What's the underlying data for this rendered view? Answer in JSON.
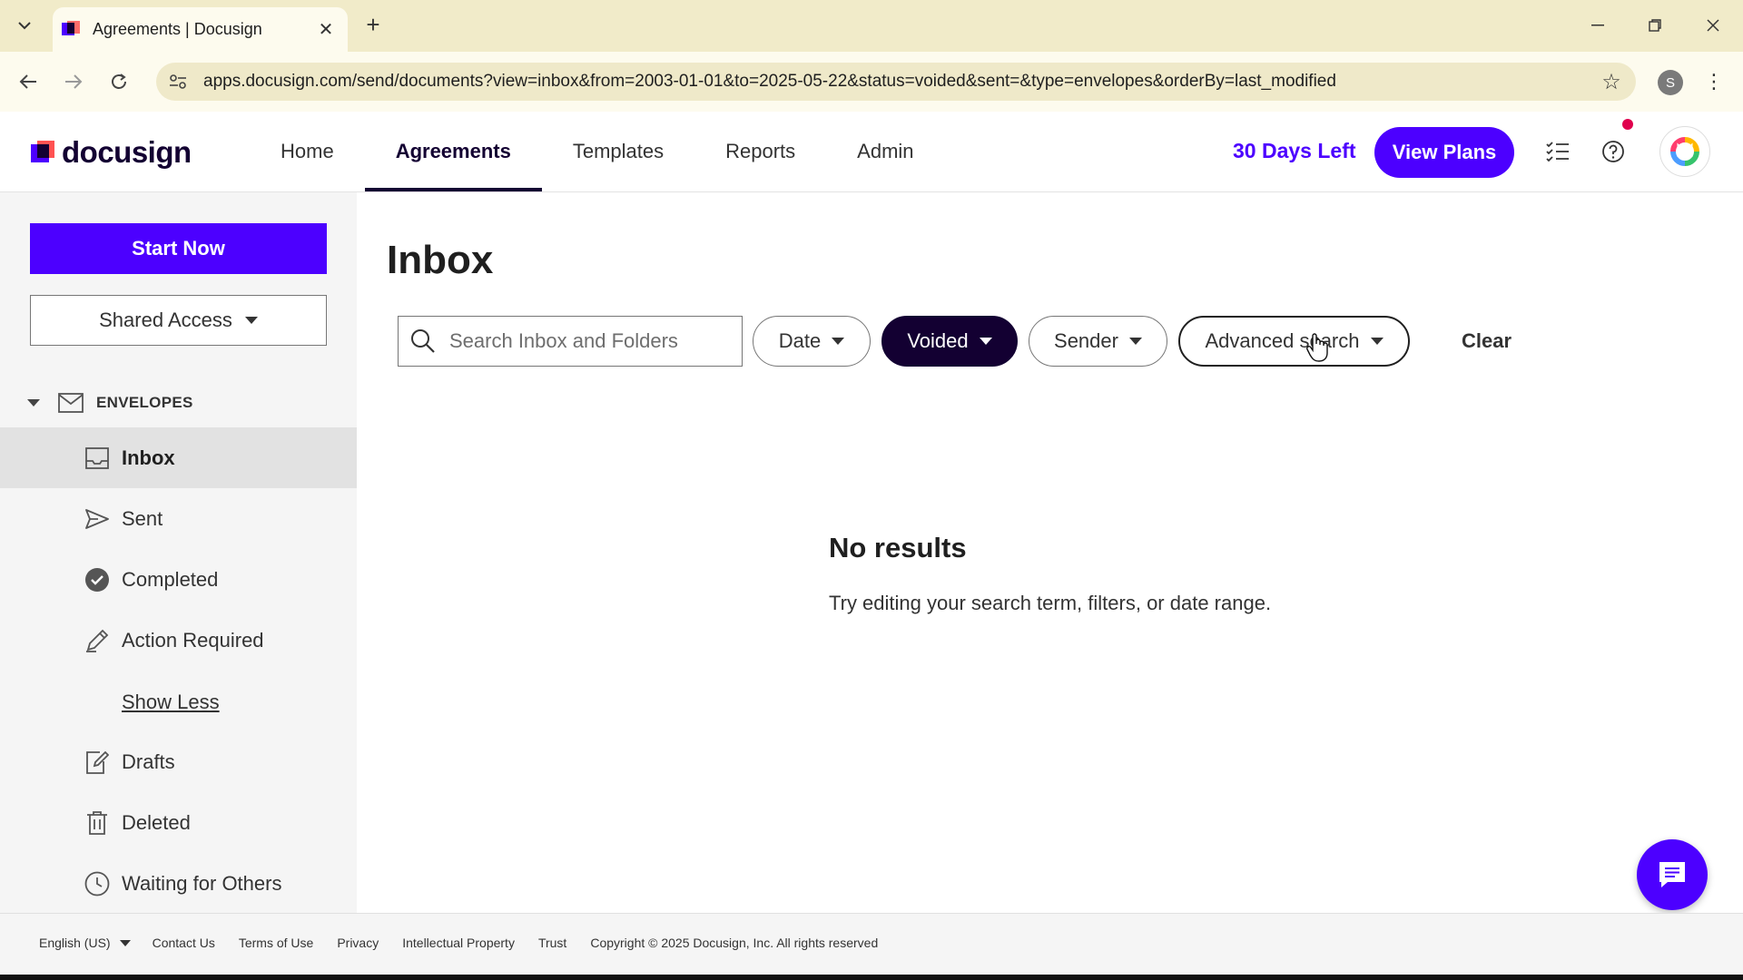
{
  "browser": {
    "tab_title": "Agreements | Docusign",
    "url": "apps.docusign.com/send/documents?view=inbox&from=2003-01-01&to=2025-05-22&status=voided&sent=&type=envelopes&orderBy=last_modified",
    "profile_initial": "S"
  },
  "header": {
    "logo_text": "docusign",
    "nav": [
      "Home",
      "Agreements",
      "Templates",
      "Reports",
      "Admin"
    ],
    "trial_text": "30 Days Left",
    "view_plans_label": "View Plans",
    "accent": "#4c00ff"
  },
  "sidebar": {
    "start_now_label": "Start Now",
    "shared_access_label": "Shared Access",
    "envelopes_label": "ENVELOPES",
    "items": [
      {
        "label": "Inbox",
        "icon": "inbox-icon"
      },
      {
        "label": "Sent",
        "icon": "send-icon"
      },
      {
        "label": "Completed",
        "icon": "check-circle-icon"
      },
      {
        "label": "Action Required",
        "icon": "pen-icon"
      },
      {
        "label": "Show Less"
      },
      {
        "label": "Drafts",
        "icon": "edit-document-icon"
      },
      {
        "label": "Deleted",
        "icon": "trash-icon"
      },
      {
        "label": "Waiting for Others",
        "icon": "clock-icon"
      }
    ]
  },
  "main": {
    "title": "Inbox",
    "search_placeholder": "Search Inbox and Folders",
    "filters": {
      "date": "Date",
      "status": "Voided",
      "sender": "Sender",
      "advanced": "Advanced search"
    },
    "clear_label": "Clear",
    "empty_title": "No results",
    "empty_sub": "Try editing your search term, filters, or date range."
  },
  "footer": {
    "language": "English (US)",
    "links": [
      "Contact Us",
      "Terms of Use",
      "Privacy",
      "Intellectual Property",
      "Trust"
    ],
    "copyright": "Copyright © 2025 Docusign, Inc. All rights reserved"
  }
}
